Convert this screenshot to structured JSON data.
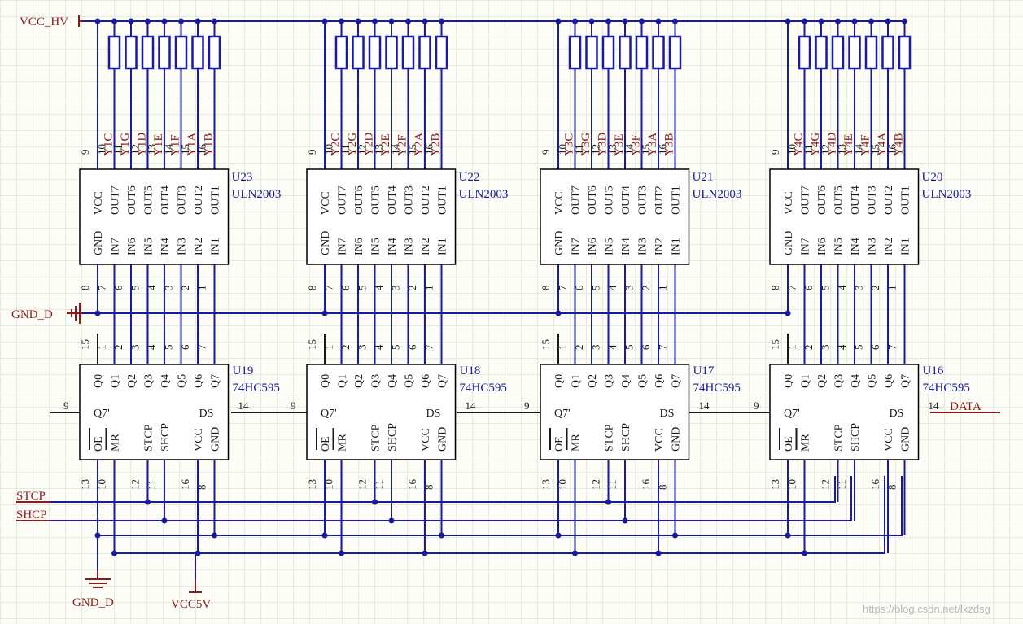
{
  "nets": {
    "vcc_hv": "VCC_HV",
    "gnd_d_left": "GND_D",
    "gnd_d_bottom": "GND_D",
    "vcc5v": "VCC5V",
    "stcp": "STCP",
    "shcp": "SHCP",
    "data": "DATA"
  },
  "uln_pin_names": {
    "top": [
      "VCC",
      "OUT7",
      "OUT6",
      "OUT5",
      "OUT4",
      "OUT3",
      "OUT2",
      "OUT1"
    ],
    "bottom": [
      "GND",
      "IN7",
      "IN6",
      "IN5",
      "IN4",
      "IN3",
      "IN2",
      "IN1"
    ]
  },
  "uln_pin_numbers": {
    "top": [
      "9",
      "10",
      "11",
      "12",
      "13",
      "14",
      "15",
      "16"
    ],
    "bottom": [
      "8",
      "7",
      "6",
      "5",
      "4",
      "3",
      "2",
      "1"
    ]
  },
  "hc595_pin_names": {
    "top": [
      "Q0",
      "Q1",
      "Q2",
      "Q3",
      "Q4",
      "Q5",
      "Q6",
      "Q7"
    ],
    "q7s": "Q7'",
    "ds": "DS",
    "bottom": [
      "OE",
      "MR",
      "STCP",
      "SHCP",
      "VCC",
      "GND"
    ]
  },
  "hc595_pin_numbers": {
    "top": [
      "15",
      "1",
      "2",
      "3",
      "4",
      "5",
      "6",
      "7"
    ],
    "q7s": "9",
    "ds": "14",
    "bottom": [
      "13",
      "10",
      "12",
      "11",
      "16",
      "8"
    ]
  },
  "stages": [
    {
      "uln": {
        "designator": "U23",
        "part": "ULN2003"
      },
      "hc595": {
        "designator": "U19",
        "part": "74HC595"
      },
      "outputs": [
        "Y1C",
        "Y1G",
        "Y1D",
        "Y1E",
        "Y1F",
        "Y1A",
        "Y1B"
      ]
    },
    {
      "uln": {
        "designator": "U22",
        "part": "ULN2003"
      },
      "hc595": {
        "designator": "U18",
        "part": "74HC595"
      },
      "outputs": [
        "Y2C",
        "Y2G",
        "Y2D",
        "Y2E",
        "Y2F",
        "Y2A",
        "Y2B"
      ]
    },
    {
      "uln": {
        "designator": "U21",
        "part": "ULN2003"
      },
      "hc595": {
        "designator": "U17",
        "part": "74HC595"
      },
      "outputs": [
        "Y3C",
        "Y3G",
        "Y3D",
        "Y3E",
        "Y3F",
        "Y3A",
        "Y3B"
      ]
    },
    {
      "uln": {
        "designator": "U20",
        "part": "ULN2003"
      },
      "hc595": {
        "designator": "U16",
        "part": "74HC595"
      },
      "outputs": [
        "Y4C",
        "Y4G",
        "Y4D",
        "Y4E",
        "Y4F",
        "Y4A",
        "Y4B"
      ]
    }
  ],
  "watermark": "https://blog.csdn.net/lxzdsg"
}
